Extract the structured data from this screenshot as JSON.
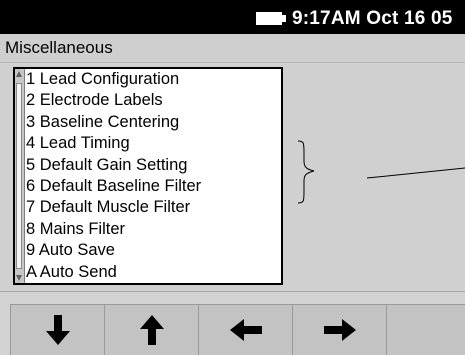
{
  "status_bar": {
    "battery_icon": "battery-icon",
    "clock": "9:17AM Oct 16 05"
  },
  "title_bar": {
    "title": "Miscellaneous"
  },
  "menu": {
    "items": [
      {
        "label": "1 Lead Configuration"
      },
      {
        "label": "2 Electrode Labels"
      },
      {
        "label": "3 Baseline Centering"
      },
      {
        "label": "4 Lead Timing"
      },
      {
        "label": "5 Default Gain Setting"
      },
      {
        "label": "6 Default Baseline Filter"
      },
      {
        "label": "7 Default Muscle Filter"
      },
      {
        "label": "8 Mains Filter"
      },
      {
        "label": "9 Auto Save"
      },
      {
        "label": "A Auto Send"
      }
    ]
  },
  "softkeys": [
    {
      "icon": "arrow-down-icon"
    },
    {
      "icon": "arrow-up-icon"
    },
    {
      "icon": "arrow-left-icon"
    },
    {
      "icon": "arrow-right-icon"
    },
    {
      "icon": ""
    }
  ]
}
